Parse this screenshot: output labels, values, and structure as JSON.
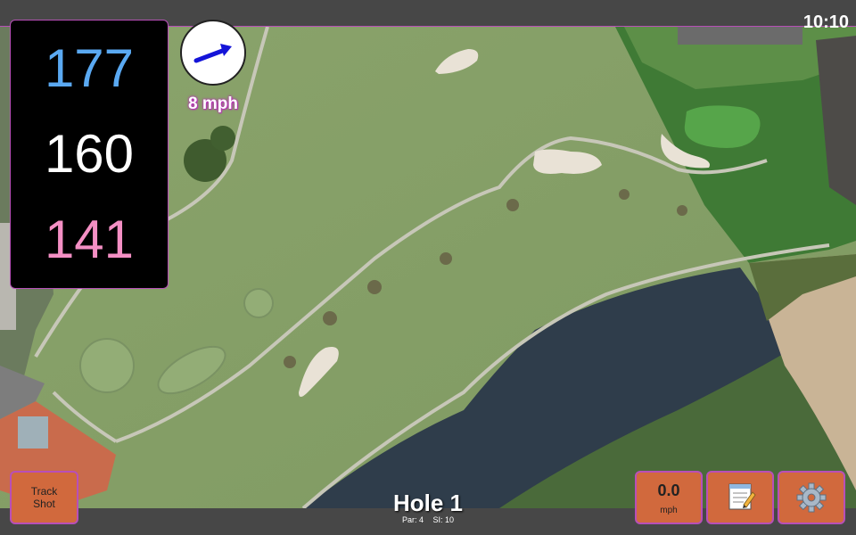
{
  "status_bar": {
    "time": "10:10"
  },
  "distances": {
    "back": "177",
    "center": "160",
    "front": "141"
  },
  "wind": {
    "speed_label": "8 mph",
    "arrow_icon": "wind-direction-arrow-icon"
  },
  "hole": {
    "title": "Hole 1",
    "par_label": "Par: 4",
    "si_label": "SI: 10"
  },
  "controls": {
    "track_shot_line1": "Track",
    "track_shot_line2": "Shot",
    "speed_value": "0.0",
    "speed_unit": "mph",
    "scorecard_icon": "notepad-icon",
    "settings_icon": "gear-icon"
  },
  "colors": {
    "back_distance": "#5aa9f2",
    "center_distance": "#ffffff",
    "front_distance": "#f48fc4",
    "button": "#d1693d",
    "accent_border": "#b84fb8"
  }
}
